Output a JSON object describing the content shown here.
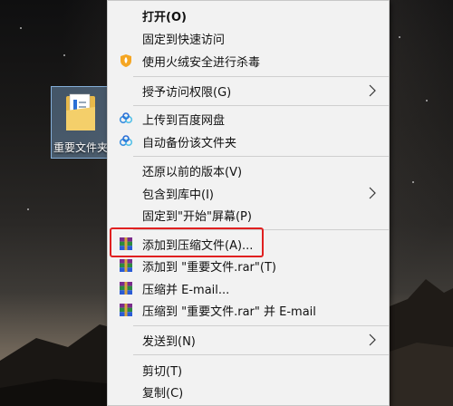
{
  "desktop": {
    "file": {
      "label": "重要文件夹"
    }
  },
  "menu": {
    "items": [
      {
        "key": "open",
        "label": "打开(O)"
      },
      {
        "key": "pin-quick",
        "label": "固定到快速访问"
      },
      {
        "key": "huorong",
        "label": "使用火绒安全进行杀毒",
        "icon": "huorong-shield-icon"
      },
      {
        "key": "grant",
        "label": "授予访问权限(G)",
        "submenu": true
      },
      {
        "key": "baidu-upload",
        "label": "上传到百度网盘",
        "icon": "baidu-cloud-icon"
      },
      {
        "key": "baidu-backup",
        "label": "自动备份该文件夹",
        "icon": "baidu-cloud-icon"
      },
      {
        "key": "restore",
        "label": "还原以前的版本(V)"
      },
      {
        "key": "library",
        "label": "包含到库中(I)",
        "submenu": true
      },
      {
        "key": "pin-start",
        "label": "固定到\"开始\"屏幕(P)"
      },
      {
        "key": "add-archive",
        "label": "添加到压缩文件(A)...",
        "icon": "winrar-icon",
        "highlighted": true
      },
      {
        "key": "add-rar",
        "label": "添加到 \"重要文件.rar\"(T)",
        "icon": "winrar-icon"
      },
      {
        "key": "email",
        "label": "压缩并 E-mail...",
        "icon": "winrar-icon"
      },
      {
        "key": "rar-email",
        "label": "压缩到 \"重要文件.rar\" 并 E-mail",
        "icon": "winrar-icon"
      },
      {
        "key": "send-to",
        "label": "发送到(N)",
        "submenu": true
      },
      {
        "key": "cut",
        "label": "剪切(T)"
      },
      {
        "key": "copy",
        "label": "复制(C)"
      }
    ]
  },
  "colors": {
    "menu_bg": "#f2f2f2",
    "highlight_border": "#e02020",
    "selection": "#99ccff"
  }
}
